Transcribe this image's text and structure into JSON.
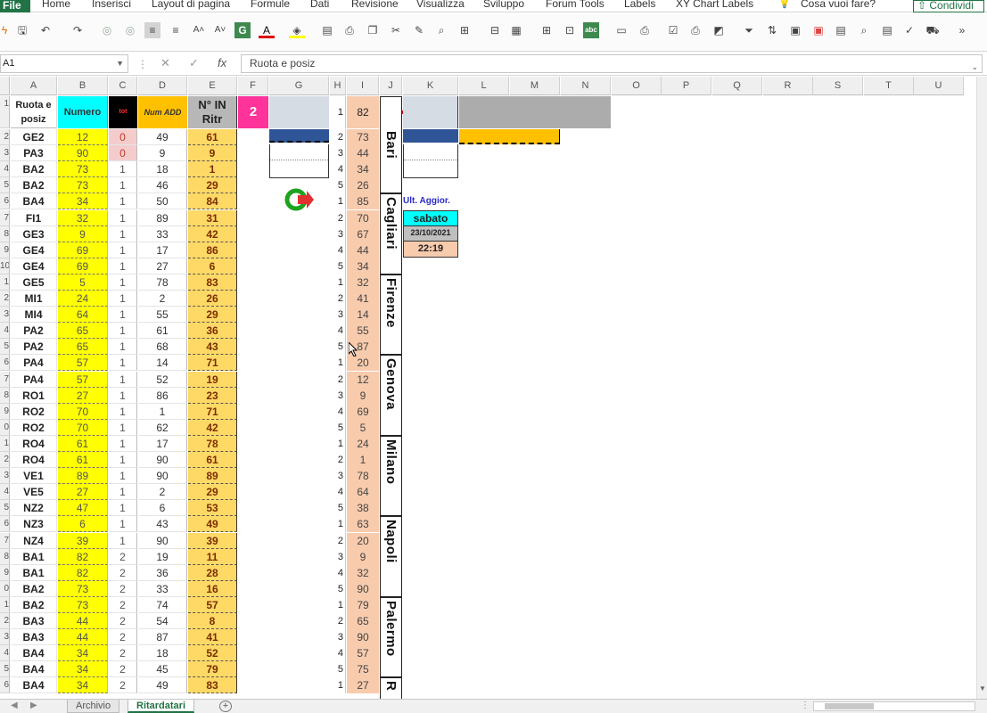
{
  "ribbon": {
    "tabs": [
      "File",
      "Home",
      "Inserisci",
      "Layout di pagina",
      "Formule",
      "Dati",
      "Revisione",
      "Visualizza",
      "Sviluppo",
      "Forum Tools",
      "Labels",
      "XY Chart Labels"
    ],
    "tell_me": "Cosa vuoi fare?",
    "share": "Condividi"
  },
  "formula_bar": {
    "name_box": "A1",
    "fx": "fx",
    "cancel": "✕",
    "enter": "✓",
    "value": "Ruota e posiz"
  },
  "columns": [
    "A",
    "B",
    "C",
    "D",
    "E",
    "F",
    "G",
    "H",
    "I",
    "J",
    "K",
    "L",
    "M",
    "N",
    "O",
    "P",
    "Q",
    "R",
    "S",
    "T",
    "U"
  ],
  "headers": {
    "ruota": "Ruota e posiz",
    "numero": "Numero",
    "tot": "tot",
    "num_add": "Num ADD",
    "n_in_ritr": "N° IN Ritr",
    "f_value": "2",
    "i_top": "82",
    "h_top": "1"
  },
  "row_numbers": [
    "",
    "1",
    "2",
    "3",
    "4",
    "5",
    "6",
    "7",
    "8",
    "9",
    "10",
    "1",
    "2",
    "3",
    "4",
    "5",
    "6",
    "7",
    "8",
    "9",
    "0",
    "1",
    "2",
    "3",
    "4",
    "5",
    "6",
    "7",
    "8",
    "9",
    "0",
    "1",
    "2",
    "3",
    "4",
    "5",
    "6",
    "7"
  ],
  "rows": [
    {
      "A": "GE2",
      "B": "12",
      "C": "0",
      "D": "49",
      "E": "61",
      "hl": true
    },
    {
      "A": "PA3",
      "B": "90",
      "C": "0",
      "D": "9",
      "E": "9",
      "hl": true
    },
    {
      "A": "BA2",
      "B": "73",
      "C": "1",
      "D": "18",
      "E": "1"
    },
    {
      "A": "BA2",
      "B": "73",
      "C": "1",
      "D": "46",
      "E": "29"
    },
    {
      "A": "BA4",
      "B": "34",
      "C": "1",
      "D": "50",
      "E": "84"
    },
    {
      "A": "FI1",
      "B": "32",
      "C": "1",
      "D": "89",
      "E": "31"
    },
    {
      "A": "GE3",
      "B": "9",
      "C": "1",
      "D": "33",
      "E": "42"
    },
    {
      "A": "GE4",
      "B": "69",
      "C": "1",
      "D": "17",
      "E": "86"
    },
    {
      "A": "GE4",
      "B": "69",
      "C": "1",
      "D": "27",
      "E": "6"
    },
    {
      "A": "GE5",
      "B": "5",
      "C": "1",
      "D": "78",
      "E": "83"
    },
    {
      "A": "MI1",
      "B": "24",
      "C": "1",
      "D": "2",
      "E": "26"
    },
    {
      "A": "MI4",
      "B": "64",
      "C": "1",
      "D": "55",
      "E": "29"
    },
    {
      "A": "PA2",
      "B": "65",
      "C": "1",
      "D": "61",
      "E": "36"
    },
    {
      "A": "PA2",
      "B": "65",
      "C": "1",
      "D": "68",
      "E": "43"
    },
    {
      "A": "PA4",
      "B": "57",
      "C": "1",
      "D": "14",
      "E": "71"
    },
    {
      "A": "PA4",
      "B": "57",
      "C": "1",
      "D": "52",
      "E": "19"
    },
    {
      "A": "RO1",
      "B": "27",
      "C": "1",
      "D": "86",
      "E": "23"
    },
    {
      "A": "RO2",
      "B": "70",
      "C": "1",
      "D": "1",
      "E": "71"
    },
    {
      "A": "RO2",
      "B": "70",
      "C": "1",
      "D": "62",
      "E": "42"
    },
    {
      "A": "RO4",
      "B": "61",
      "C": "1",
      "D": "17",
      "E": "78"
    },
    {
      "A": "RO4",
      "B": "61",
      "C": "1",
      "D": "90",
      "E": "61"
    },
    {
      "A": "VE1",
      "B": "89",
      "C": "1",
      "D": "90",
      "E": "89"
    },
    {
      "A": "VE5",
      "B": "27",
      "C": "1",
      "D": "2",
      "E": "29"
    },
    {
      "A": "NZ2",
      "B": "47",
      "C": "1",
      "D": "6",
      "E": "53"
    },
    {
      "A": "NZ3",
      "B": "6",
      "C": "1",
      "D": "43",
      "E": "49"
    },
    {
      "A": "NZ4",
      "B": "39",
      "C": "1",
      "D": "90",
      "E": "39"
    },
    {
      "A": "BA1",
      "B": "82",
      "C": "2",
      "D": "19",
      "E": "11"
    },
    {
      "A": "BA1",
      "B": "82",
      "C": "2",
      "D": "36",
      "E": "28"
    },
    {
      "A": "BA2",
      "B": "73",
      "C": "2",
      "D": "33",
      "E": "16"
    },
    {
      "A": "BA2",
      "B": "73",
      "C": "2",
      "D": "74",
      "E": "57"
    },
    {
      "A": "BA3",
      "B": "44",
      "C": "2",
      "D": "54",
      "E": "8"
    },
    {
      "A": "BA3",
      "B": "44",
      "C": "2",
      "D": "87",
      "E": "41"
    },
    {
      "A": "BA4",
      "B": "34",
      "C": "2",
      "D": "18",
      "E": "52"
    },
    {
      "A": "BA4",
      "B": "34",
      "C": "2",
      "D": "45",
      "E": "79"
    },
    {
      "A": "BA4",
      "B": "34",
      "C": "2",
      "D": "49",
      "E": "83"
    }
  ],
  "hi_column": [
    {
      "h": "2",
      "i": "73"
    },
    {
      "h": "3",
      "i": "44"
    },
    {
      "h": "4",
      "i": "34"
    },
    {
      "h": "5",
      "i": "26"
    },
    {
      "h": "1",
      "i": "85"
    },
    {
      "h": "2",
      "i": "70"
    },
    {
      "h": "3",
      "i": "67"
    },
    {
      "h": "4",
      "i": "44"
    },
    {
      "h": "5",
      "i": "34"
    },
    {
      "h": "1",
      "i": "32"
    },
    {
      "h": "2",
      "i": "41"
    },
    {
      "h": "3",
      "i": "14"
    },
    {
      "h": "4",
      "i": "55"
    },
    {
      "h": "5",
      "i": "87"
    },
    {
      "h": "1",
      "i": "20"
    },
    {
      "h": "2",
      "i": "12"
    },
    {
      "h": "3",
      "i": "9"
    },
    {
      "h": "4",
      "i": "69"
    },
    {
      "h": "5",
      "i": "5"
    },
    {
      "h": "1",
      "i": "24"
    },
    {
      "h": "2",
      "i": "1"
    },
    {
      "h": "3",
      "i": "78"
    },
    {
      "h": "4",
      "i": "64"
    },
    {
      "h": "5",
      "i": "38"
    },
    {
      "h": "1",
      "i": "63"
    },
    {
      "h": "2",
      "i": "20"
    },
    {
      "h": "3",
      "i": "9"
    },
    {
      "h": "4",
      "i": "32"
    },
    {
      "h": "5",
      "i": "90"
    },
    {
      "h": "1",
      "i": "79"
    },
    {
      "h": "2",
      "i": "65"
    },
    {
      "h": "3",
      "i": "90"
    },
    {
      "h": "4",
      "i": "57"
    },
    {
      "h": "5",
      "i": "75"
    },
    {
      "h": "1",
      "i": "27"
    }
  ],
  "cities": [
    "Bari",
    "Cagliari",
    "Firenze",
    "Genova",
    "Milano",
    "Napoli",
    "Palermo",
    "R"
  ],
  "update_box": {
    "title": "Ult. Aggior.",
    "day": "sabato",
    "date": "23/10/2021",
    "time": "22:19"
  },
  "sheet_tabs": [
    "Archivio",
    "Ritardatari"
  ],
  "active_sheet": "Ritardatari",
  "colors": {
    "excel_green": "#217346",
    "yellow": "#ffff00",
    "cyan": "#00ffff",
    "orange": "#ffc000",
    "peach": "#f8cbad",
    "gold": "#ffd966",
    "pink": "#ff3399",
    "navy": "#2f5597"
  }
}
